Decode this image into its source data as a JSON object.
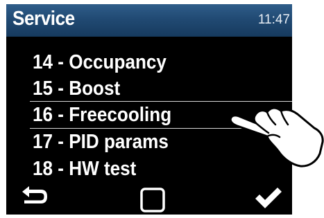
{
  "header": {
    "title": "Service",
    "time": "11:47"
  },
  "menu": {
    "items": [
      {
        "label": "14 - Occupancy"
      },
      {
        "label": "15 - Boost"
      },
      {
        "label": "16 - Freecooling"
      },
      {
        "label": "17 - PID params"
      },
      {
        "label": "18 - HW test"
      }
    ],
    "selected_index": 2
  },
  "footer": {
    "back_icon": "back-arrow-icon",
    "home_icon": "square-icon",
    "confirm_icon": "checkmark-icon"
  },
  "colors": {
    "header_bg": "#214a73",
    "screen_bg": "#000000",
    "text": "#ffffff"
  }
}
